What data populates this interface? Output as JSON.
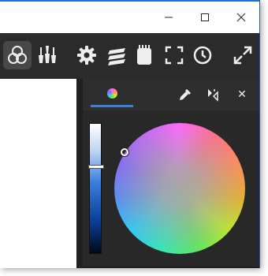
{
  "window": {
    "controls": {
      "minimize_glyph": "—",
      "maximize_glyph": "☐",
      "close_glyph": "✕"
    }
  },
  "toolbar": {
    "items": [
      {
        "icon": "color-circles-icon",
        "active": true
      },
      {
        "icon": "brushes-icon"
      },
      {
        "icon": "gear-icon"
      },
      {
        "icon": "layers-icon"
      },
      {
        "icon": "notepad-icon"
      },
      {
        "icon": "fullscreen-icon"
      },
      {
        "icon": "clock-icon"
      },
      {
        "icon": "expand-icon"
      }
    ]
  },
  "color_panel": {
    "tabs": [
      {
        "icon": "color-wheel-icon",
        "active": true
      }
    ],
    "tools": [
      "eyedropper-icon",
      "swap-icon",
      "close-icon"
    ],
    "close_glyph": "✕",
    "lightness_level": 0.33,
    "accent_color": "#3d7fd6"
  }
}
